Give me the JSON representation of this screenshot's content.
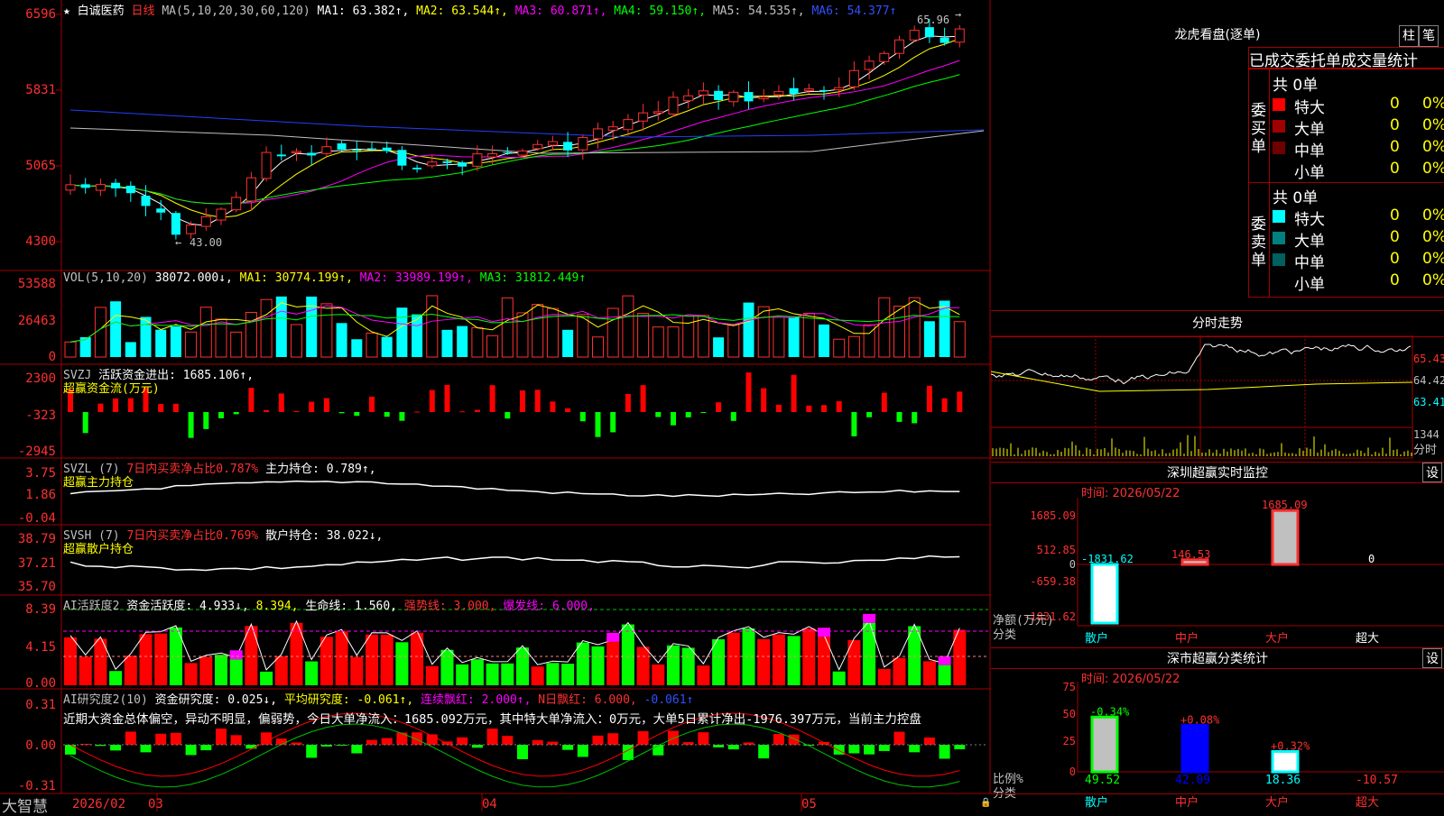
{
  "stock": {
    "name": "白诚医药",
    "period": "日线",
    "star": "★"
  },
  "main": {
    "ma_header": "MA(5,10,20,30,60,120)",
    "ma": [
      {
        "label": "MA1: 63.382↑,",
        "color": "#ffffff"
      },
      {
        "label": "MA2: 63.544↑,",
        "color": "#ffff00"
      },
      {
        "label": "MA3: 60.871↑,",
        "color": "#ff00ff"
      },
      {
        "label": "MA4: 59.150↑,",
        "color": "#00ff00"
      },
      {
        "label": "MA5: 54.535↑,",
        "color": "#c0c0c0"
      },
      {
        "label": "MA6: 54.377↑",
        "color": "#0000ff"
      }
    ],
    "yticks": [
      "6596",
      "5831",
      "5065",
      "4300"
    ],
    "high_mark": "65.96",
    "low_mark": "43.00"
  },
  "vol": {
    "header": "VOL(5,10,20)",
    "value": "38072.000↓,",
    "ma1": "MA1: 30774.199↑,",
    "ma2": "MA2: 33989.199↑,",
    "ma3": "MA3: 31812.449↑",
    "yticks": [
      "53588",
      "26463",
      "0"
    ]
  },
  "svzj": {
    "header": "SVZJ",
    "item": "活跃资金进出: 1685.106↑,",
    "sub": "超赢资金流(万元)",
    "yticks": [
      "2300",
      "-323",
      "-2945"
    ]
  },
  "svzl": {
    "header": "SVZL (7)",
    "item1": "7日内买卖净占比0.787%",
    "item2": "主力持仓: 0.789↑,",
    "sub": "超赢主力持仓",
    "yticks": [
      "3.75",
      "1.86",
      "-0.04"
    ]
  },
  "svsh": {
    "header": "SVSH (7)",
    "item1": "7日内买卖净占比0.769%",
    "item2": "散户持仓: 38.022↓,",
    "sub": "超赢散户持仓",
    "yticks": [
      "38.79",
      "37.21",
      "35.70"
    ]
  },
  "ai1": {
    "header": "AI活跃度2",
    "item1": "资金活跃度: 4.933↓,",
    "item2": "8.394,",
    "item3": "生命线: 1.560,",
    "item4": "强势线: 3.000,",
    "item5": "爆发线: 6.000,",
    "yticks": [
      "8.39",
      "4.15",
      "0.00"
    ]
  },
  "ai2": {
    "header": "AI研究度2(10)",
    "item1": "资金研究度: 0.025↓,",
    "item2": "平均研究度: -0.061↑,",
    "item3": "连续飘红: 2.000↑,",
    "item4": "N日飘红: 6.000,",
    "item5": "-0.061↑",
    "commentary": "近期大资金总体偏空，异动不明显，偏弱势，今日大单净流入：1685.092万元，其中特大单净流入：0万元，大单5日累计净出-1976.397万元，当前主力控盘",
    "yticks": [
      "0.31",
      "0.00",
      "-0.31"
    ]
  },
  "bottom": {
    "brand": "大智慧",
    "dates": [
      "2026/02",
      "03",
      "04",
      "05"
    ]
  },
  "dragon": {
    "title": "龙虎看盘(逐单)",
    "btn_zhu": "柱",
    "btn_bi": "笔",
    "header": "已成交委托单成交量统计",
    "buy_label": "委买单",
    "sell_label": "委卖单",
    "buy_total": "共 0单",
    "sell_total": "共 0单",
    "buy_rows": [
      {
        "name": "特大",
        "val": "0",
        "pct": "0%",
        "color": "#ff0000"
      },
      {
        "name": "大单",
        "val": "0",
        "pct": "0%",
        "color": "#a00000"
      },
      {
        "name": "中单",
        "val": "0",
        "pct": "0%",
        "color": "#700000"
      },
      {
        "name": "小单",
        "val": "0",
        "pct": "0%",
        "color": "#000000"
      }
    ],
    "sell_rows": [
      {
        "name": "特大",
        "val": "0",
        "pct": "0%",
        "color": "#00ffff"
      },
      {
        "name": "大单",
        "val": "0",
        "pct": "0%",
        "color": "#008080"
      },
      {
        "name": "中单",
        "val": "0",
        "pct": "0%",
        "color": "#006060"
      },
      {
        "name": "小单",
        "val": "0",
        "pct": "0%",
        "color": "#000000"
      }
    ]
  },
  "intraday": {
    "title": "分时走势",
    "price_ticks": [
      "65.43",
      "64.42",
      "63.41"
    ],
    "vol_tick": "1344",
    "vol_label": "分时"
  },
  "monitor": {
    "title": "深圳超赢实时监控",
    "set": "设",
    "time": "时间: 2026/05/22",
    "yticks": [
      "1685.09",
      "512.85",
      "0",
      "-659.38",
      "-1831.62"
    ],
    "ylabel1": "净额(万元)",
    "ylabel2": "分类",
    "values": [
      "-1831.62",
      "146.53",
      "1685.09",
      "0"
    ],
    "cats": [
      "散户",
      "中户",
      "大户",
      "超大"
    ]
  },
  "stats": {
    "title": "深市超赢分类统计",
    "set": "设",
    "time": "时间: 2026/05/22",
    "yticks": [
      "75",
      "50",
      "25",
      "0"
    ],
    "ylabel1": "比例%",
    "ylabel2": "分类",
    "changes": [
      "-0.34%",
      "+0.08%",
      "+0.32%"
    ],
    "values": [
      "49.52",
      "42.09",
      "18.36",
      "-10.57"
    ],
    "cats": [
      "散户",
      "中户",
      "大户",
      "超大"
    ]
  }
}
